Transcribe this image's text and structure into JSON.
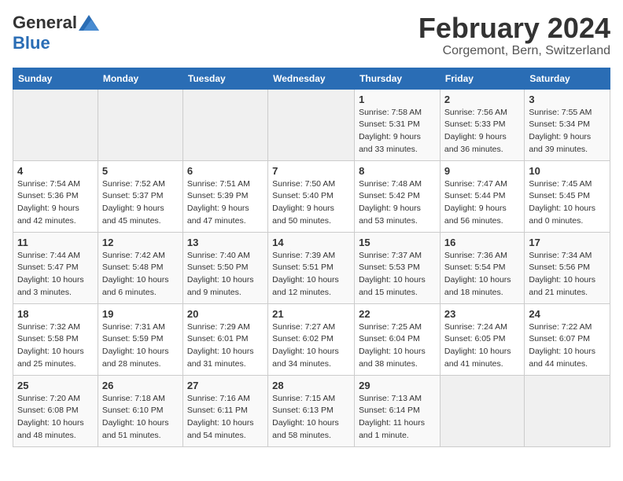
{
  "logo": {
    "general": "General",
    "blue": "Blue"
  },
  "header": {
    "month": "February 2024",
    "location": "Corgemont, Bern, Switzerland"
  },
  "weekdays": [
    "Sunday",
    "Monday",
    "Tuesday",
    "Wednesday",
    "Thursday",
    "Friday",
    "Saturday"
  ],
  "weeks": [
    [
      {
        "day": "",
        "info": ""
      },
      {
        "day": "",
        "info": ""
      },
      {
        "day": "",
        "info": ""
      },
      {
        "day": "",
        "info": ""
      },
      {
        "day": "1",
        "info": "Sunrise: 7:58 AM\nSunset: 5:31 PM\nDaylight: 9 hours\nand 33 minutes."
      },
      {
        "day": "2",
        "info": "Sunrise: 7:56 AM\nSunset: 5:33 PM\nDaylight: 9 hours\nand 36 minutes."
      },
      {
        "day": "3",
        "info": "Sunrise: 7:55 AM\nSunset: 5:34 PM\nDaylight: 9 hours\nand 39 minutes."
      }
    ],
    [
      {
        "day": "4",
        "info": "Sunrise: 7:54 AM\nSunset: 5:36 PM\nDaylight: 9 hours\nand 42 minutes."
      },
      {
        "day": "5",
        "info": "Sunrise: 7:52 AM\nSunset: 5:37 PM\nDaylight: 9 hours\nand 45 minutes."
      },
      {
        "day": "6",
        "info": "Sunrise: 7:51 AM\nSunset: 5:39 PM\nDaylight: 9 hours\nand 47 minutes."
      },
      {
        "day": "7",
        "info": "Sunrise: 7:50 AM\nSunset: 5:40 PM\nDaylight: 9 hours\nand 50 minutes."
      },
      {
        "day": "8",
        "info": "Sunrise: 7:48 AM\nSunset: 5:42 PM\nDaylight: 9 hours\nand 53 minutes."
      },
      {
        "day": "9",
        "info": "Sunrise: 7:47 AM\nSunset: 5:44 PM\nDaylight: 9 hours\nand 56 minutes."
      },
      {
        "day": "10",
        "info": "Sunrise: 7:45 AM\nSunset: 5:45 PM\nDaylight: 10 hours\nand 0 minutes."
      }
    ],
    [
      {
        "day": "11",
        "info": "Sunrise: 7:44 AM\nSunset: 5:47 PM\nDaylight: 10 hours\nand 3 minutes."
      },
      {
        "day": "12",
        "info": "Sunrise: 7:42 AM\nSunset: 5:48 PM\nDaylight: 10 hours\nand 6 minutes."
      },
      {
        "day": "13",
        "info": "Sunrise: 7:40 AM\nSunset: 5:50 PM\nDaylight: 10 hours\nand 9 minutes."
      },
      {
        "day": "14",
        "info": "Sunrise: 7:39 AM\nSunset: 5:51 PM\nDaylight: 10 hours\nand 12 minutes."
      },
      {
        "day": "15",
        "info": "Sunrise: 7:37 AM\nSunset: 5:53 PM\nDaylight: 10 hours\nand 15 minutes."
      },
      {
        "day": "16",
        "info": "Sunrise: 7:36 AM\nSunset: 5:54 PM\nDaylight: 10 hours\nand 18 minutes."
      },
      {
        "day": "17",
        "info": "Sunrise: 7:34 AM\nSunset: 5:56 PM\nDaylight: 10 hours\nand 21 minutes."
      }
    ],
    [
      {
        "day": "18",
        "info": "Sunrise: 7:32 AM\nSunset: 5:58 PM\nDaylight: 10 hours\nand 25 minutes."
      },
      {
        "day": "19",
        "info": "Sunrise: 7:31 AM\nSunset: 5:59 PM\nDaylight: 10 hours\nand 28 minutes."
      },
      {
        "day": "20",
        "info": "Sunrise: 7:29 AM\nSunset: 6:01 PM\nDaylight: 10 hours\nand 31 minutes."
      },
      {
        "day": "21",
        "info": "Sunrise: 7:27 AM\nSunset: 6:02 PM\nDaylight: 10 hours\nand 34 minutes."
      },
      {
        "day": "22",
        "info": "Sunrise: 7:25 AM\nSunset: 6:04 PM\nDaylight: 10 hours\nand 38 minutes."
      },
      {
        "day": "23",
        "info": "Sunrise: 7:24 AM\nSunset: 6:05 PM\nDaylight: 10 hours\nand 41 minutes."
      },
      {
        "day": "24",
        "info": "Sunrise: 7:22 AM\nSunset: 6:07 PM\nDaylight: 10 hours\nand 44 minutes."
      }
    ],
    [
      {
        "day": "25",
        "info": "Sunrise: 7:20 AM\nSunset: 6:08 PM\nDaylight: 10 hours\nand 48 minutes."
      },
      {
        "day": "26",
        "info": "Sunrise: 7:18 AM\nSunset: 6:10 PM\nDaylight: 10 hours\nand 51 minutes."
      },
      {
        "day": "27",
        "info": "Sunrise: 7:16 AM\nSunset: 6:11 PM\nDaylight: 10 hours\nand 54 minutes."
      },
      {
        "day": "28",
        "info": "Sunrise: 7:15 AM\nSunset: 6:13 PM\nDaylight: 10 hours\nand 58 minutes."
      },
      {
        "day": "29",
        "info": "Sunrise: 7:13 AM\nSunset: 6:14 PM\nDaylight: 11 hours\nand 1 minute."
      },
      {
        "day": "",
        "info": ""
      },
      {
        "day": "",
        "info": ""
      }
    ]
  ]
}
